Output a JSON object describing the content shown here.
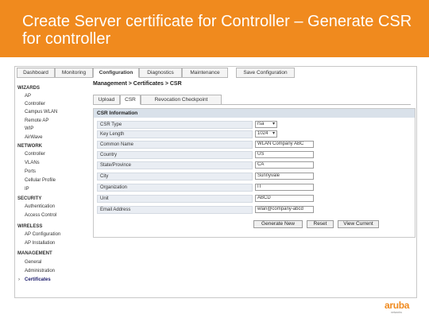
{
  "slide": {
    "title": "Create Server certificate for Controller – Generate CSR for controller"
  },
  "topnav": {
    "tabs": [
      "Dashboard",
      "Monitoring",
      "Configuration",
      "Diagnostics",
      "Maintenance",
      "Save Configuration"
    ],
    "active": "Configuration"
  },
  "sidebar": {
    "sections": [
      {
        "heading": "WIZARDS",
        "items": [
          "AP",
          "Controller",
          "Campus WLAN",
          "Remote AP",
          "WIP",
          "AirWave"
        ]
      },
      {
        "heading": "NETWORK",
        "items": [
          "Controller",
          "VLANs",
          "Ports",
          "Cellular Profile",
          "IP"
        ]
      },
      {
        "heading": "SECURITY",
        "items": [
          "Authentication",
          "Access Control"
        ]
      },
      {
        "heading": "WIRELESS",
        "items": [
          "AP Configuration",
          "AP Installation"
        ]
      },
      {
        "heading": "MANAGEMENT",
        "items": [
          "General",
          "Administration",
          "Certificates"
        ]
      }
    ],
    "selected": "Certificates",
    "selected_marker": "›"
  },
  "breadcrumb": "Management > Certificates > CSR",
  "subtabs": {
    "items": [
      "Upload",
      "CSR",
      "Revocation Checkpoint"
    ],
    "active": "CSR"
  },
  "csr": {
    "header": "CSR Information",
    "fields": [
      {
        "label": "CSR Type",
        "value": "rsa",
        "type": "select"
      },
      {
        "label": "Key Length",
        "value": "1024",
        "type": "select"
      },
      {
        "label": "Common Name",
        "value": "WLAN Company ABC",
        "type": "text"
      },
      {
        "label": "Country",
        "value": "US",
        "type": "text"
      },
      {
        "label": "State/Province",
        "value": "CA",
        "type": "text"
      },
      {
        "label": "City",
        "value": "Sunnyvale",
        "type": "text"
      },
      {
        "label": "Organization",
        "value": "IT",
        "type": "text"
      },
      {
        "label": "Unit",
        "value": "ABCD",
        "type": "text"
      },
      {
        "label": "Email Address",
        "value": "wlan@company-abcd",
        "type": "text"
      }
    ],
    "buttons": [
      "Generate New",
      "Reset",
      "View Current"
    ]
  },
  "logo": {
    "wordmark": "aruba",
    "subtext": "networks"
  },
  "colors": {
    "banner": "#f08a1e",
    "panel_header": "#d9e1ea",
    "label_bg": "#e9edf3"
  }
}
